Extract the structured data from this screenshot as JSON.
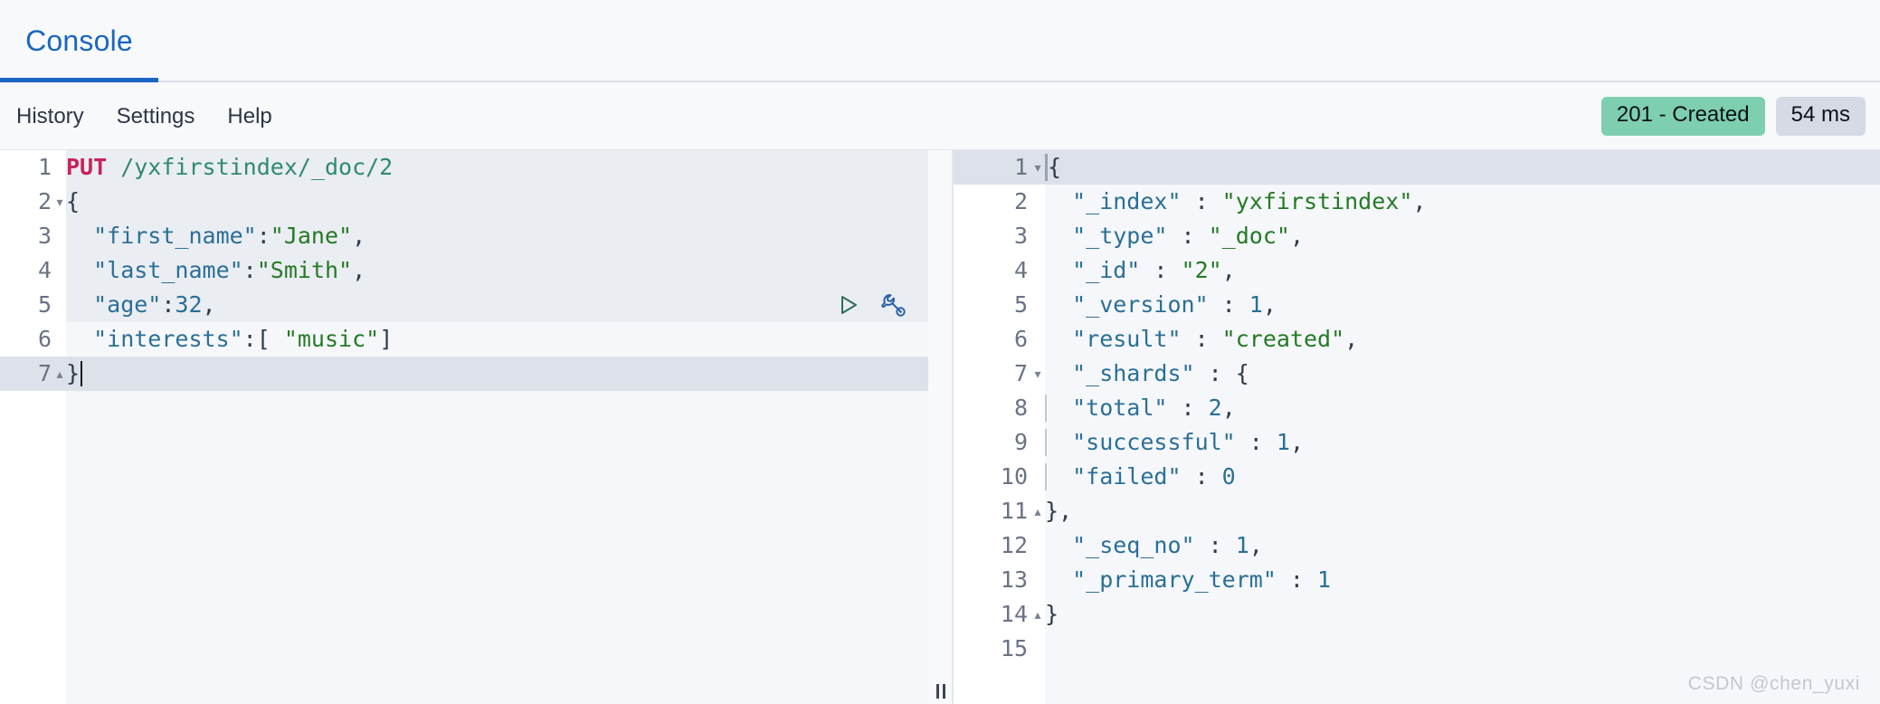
{
  "tabs": [
    {
      "label": "Console",
      "active": true
    }
  ],
  "toolbar": {
    "links": [
      {
        "label": "History"
      },
      {
        "label": "Settings"
      },
      {
        "label": "Help"
      }
    ],
    "status_badge": "201 - Created",
    "time_badge": "54 ms",
    "status_badge_color": "#7dcfb0",
    "time_badge_color": "#d5dae4"
  },
  "editor": {
    "actions": [
      {
        "name": "play-icon",
        "title": "Click to send request"
      },
      {
        "name": "wrench-icon",
        "title": "Open documentation / tools"
      }
    ],
    "lines": [
      {
        "num": "1",
        "fold": "",
        "active": false
      },
      {
        "num": "2",
        "fold": "▾",
        "active": false
      },
      {
        "num": "3",
        "fold": "",
        "active": false
      },
      {
        "num": "4",
        "fold": "",
        "active": false
      },
      {
        "num": "5",
        "fold": "",
        "active": false
      },
      {
        "num": "6",
        "fold": "",
        "active": false
      },
      {
        "num": "7",
        "fold": "▴",
        "active": true
      }
    ],
    "text": {
      "l1_method": "PUT",
      "l1_path": " /yxfirstindex/_doc/2",
      "l2": "{",
      "l3_key": "  \"first_name\"",
      "l3_colon": ":",
      "l3_val": "\"Jane\"",
      "l3_comma": ",",
      "l4_key": "  \"last_name\"",
      "l4_colon": ":",
      "l4_val": "\"Smith\"",
      "l4_comma": ",",
      "l5_key": "  \"age\"",
      "l5_colon": ":",
      "l5_val": "32",
      "l5_comma": ",",
      "l6_key": "  \"interests\"",
      "l6_colon": ":[ ",
      "l6_val": "\"music\"",
      "l6_close": "]",
      "l7": "}"
    }
  },
  "response": {
    "lines": [
      {
        "num": "1",
        "fold": "▾",
        "active": true
      },
      {
        "num": "2",
        "fold": "",
        "active": false
      },
      {
        "num": "3",
        "fold": "",
        "active": false
      },
      {
        "num": "4",
        "fold": "",
        "active": false
      },
      {
        "num": "5",
        "fold": "",
        "active": false
      },
      {
        "num": "6",
        "fold": "",
        "active": false
      },
      {
        "num": "7",
        "fold": "▾",
        "active": false
      },
      {
        "num": "8",
        "fold": "",
        "active": false
      },
      {
        "num": "9",
        "fold": "",
        "active": false
      },
      {
        "num": "10",
        "fold": "",
        "active": false
      },
      {
        "num": "11",
        "fold": "▴",
        "active": false
      },
      {
        "num": "12",
        "fold": "",
        "active": false
      },
      {
        "num": "13",
        "fold": "",
        "active": false
      },
      {
        "num": "14",
        "fold": "▴",
        "active": false
      },
      {
        "num": "15",
        "fold": "",
        "active": false
      }
    ],
    "text": {
      "l1": "{",
      "l2_key": "  \"_index\"",
      "l2_sep": " : ",
      "l2_val": "\"yxfirstindex\"",
      "l2_comma": ",",
      "l3_key": "  \"_type\"",
      "l3_sep": " : ",
      "l3_val": "\"_doc\"",
      "l3_comma": ",",
      "l4_key": "  \"_id\"",
      "l4_sep": " : ",
      "l4_val": "\"2\"",
      "l4_comma": ",",
      "l5_key": "  \"_version\"",
      "l5_sep": " : ",
      "l5_val": "1",
      "l5_comma": ",",
      "l6_key": "  \"result\"",
      "l6_sep": " : ",
      "l6_val": "\"created\"",
      "l6_comma": ",",
      "l7_key": "  \"_shards\"",
      "l7_sep": " : ",
      "l7_val": "{",
      "l8_key": "  \"total\"",
      "l8_sep": " : ",
      "l8_val": "2",
      "l8_comma": ",",
      "l9_key": "  \"successful\"",
      "l9_sep": " : ",
      "l9_val": "1",
      "l9_comma": ",",
      "l10_key": "  \"failed\"",
      "l10_sep": " : ",
      "l10_val": "0",
      "l11": "},",
      "l12_key": "  \"_seq_no\"",
      "l12_sep": " : ",
      "l12_val": "1",
      "l12_comma": ",",
      "l13_key": "  \"_primary_term\"",
      "l13_sep": " : ",
      "l13_val": "1",
      "l14": "}",
      "l15": ""
    }
  },
  "watermark": "CSDN @chen_yuxi"
}
